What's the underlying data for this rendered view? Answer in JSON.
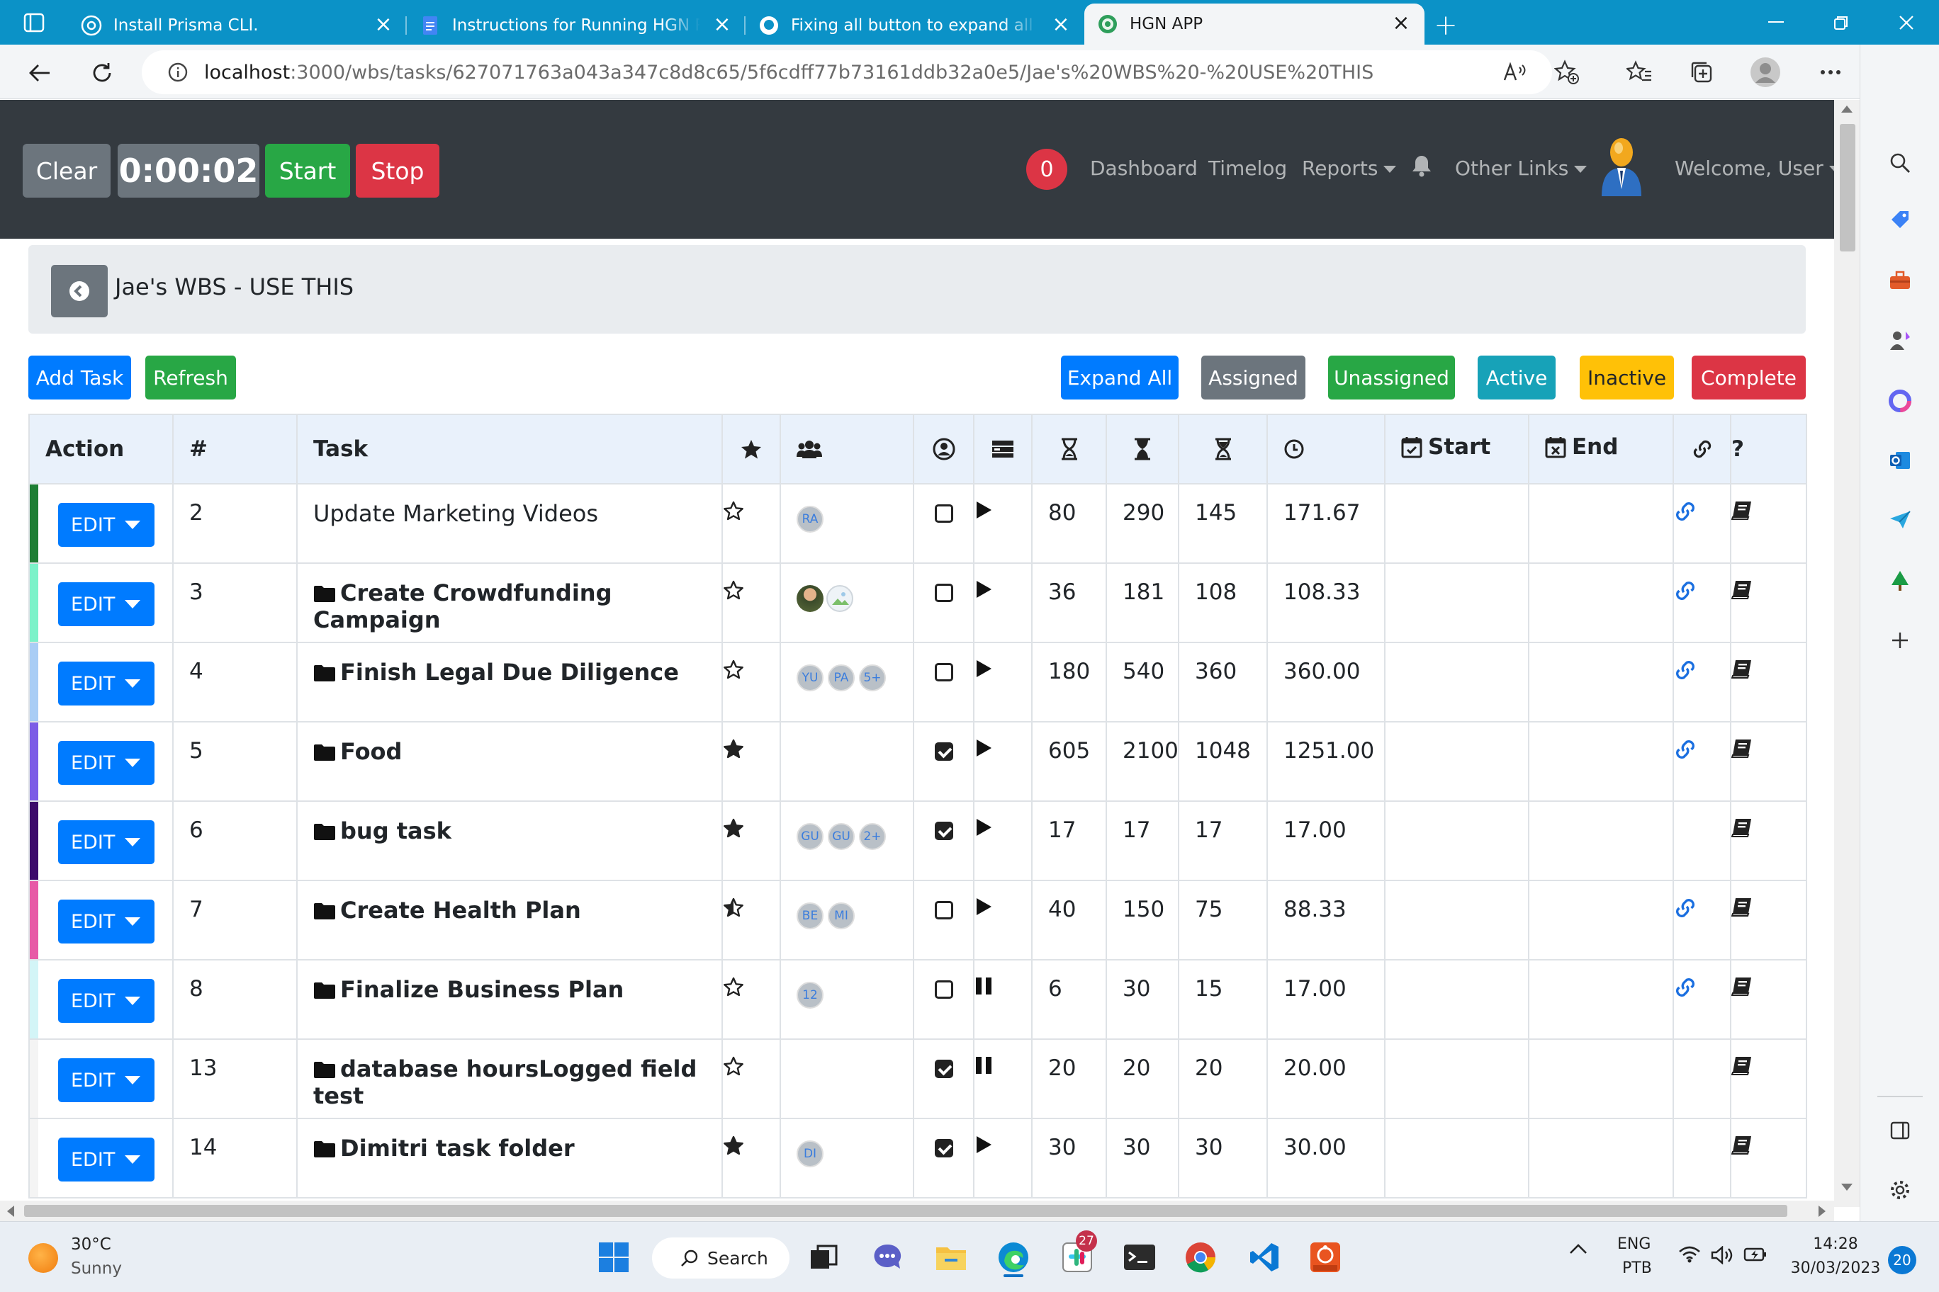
{
  "browser": {
    "tabs": [
      {
        "title": "Install Prisma CLI.",
        "icon": "openai-icon"
      },
      {
        "title": "Instructions for Running HGN Re",
        "icon": "docs-icon"
      },
      {
        "title": "Fixing all button to expand all ta",
        "icon": "github-icon"
      },
      {
        "title": "HGN APP",
        "icon": "hgn-icon",
        "active": true
      }
    ],
    "url_host": "localhost",
    "url_path": ":3000/wbs/tasks/627071763a043a347c8d8c65/5f6cdff77b73161ddb32a0e5/Jae's%20WBS%20-%20USE%20THIS"
  },
  "navbar": {
    "timer": {
      "clear": "Clear",
      "time": "0:00:02",
      "start": "Start",
      "stop": "Stop"
    },
    "notifications": "0",
    "links": {
      "dashboard": "Dashboard",
      "timelog": "Timelog",
      "reports": "Reports",
      "other_links": "Other Links",
      "welcome": "Welcome, User"
    }
  },
  "page": {
    "title": "Jae's WBS - USE THIS",
    "buttons": {
      "add_task": "Add Task",
      "refresh": "Refresh",
      "expand_all": "Expand All",
      "assigned": "Assigned",
      "unassigned": "Unassigned",
      "active": "Active",
      "inactive": "Inactive",
      "complete": "Complete"
    },
    "colors": {
      "primary": "#007bff",
      "success": "#28a745",
      "secondary": "#6c757d",
      "info": "#17a2b8",
      "warning": "#ffc107",
      "danger": "#dc3545"
    }
  },
  "table": {
    "headers": {
      "action": "Action",
      "num": "#",
      "task": "Task",
      "start": "Start",
      "end": "End",
      "help": "?"
    },
    "edit_label": "EDIT",
    "rows": [
      {
        "num": "2",
        "name": "Update Marketing Videos",
        "folder": false,
        "star": "empty",
        "avatars": [
          "RA"
        ],
        "photos": 0,
        "checked": false,
        "status": "play",
        "h1": "80",
        "h2": "290",
        "h3": "145",
        "h4": "171.67",
        "link": true,
        "color": "#1e7e34"
      },
      {
        "num": "3",
        "name": "Create Crowdfunding Campaign",
        "folder": true,
        "star": "empty",
        "avatars": [],
        "photos": 2,
        "checked": false,
        "status": "play",
        "h1": "36",
        "h2": "181",
        "h3": "108",
        "h4": "108.33",
        "link": true,
        "color": "#7cf2c9"
      },
      {
        "num": "4",
        "name": "Finish Legal Due Diligence",
        "folder": true,
        "star": "empty",
        "avatars": [
          "YU",
          "PA",
          "5+"
        ],
        "photos": 0,
        "checked": false,
        "status": "play",
        "h1": "180",
        "h2": "540",
        "h3": "360",
        "h4": "360.00",
        "link": true,
        "color": "#a9cdf5"
      },
      {
        "num": "5",
        "name": "Food",
        "folder": true,
        "star": "full",
        "avatars": [],
        "photos": 0,
        "checked": true,
        "status": "play",
        "h1": "605",
        "h2": "2100",
        "h3": "1048",
        "h4": "1251.00",
        "link": true,
        "color": "#7c5ce6"
      },
      {
        "num": "6",
        "name": "bug task",
        "folder": true,
        "star": "full",
        "avatars": [
          "GU",
          "GU",
          "2+"
        ],
        "photos": 0,
        "checked": true,
        "status": "play",
        "h1": "17",
        "h2": "17",
        "h3": "17",
        "h4": "17.00",
        "link": false,
        "color": "#3c0a6b"
      },
      {
        "num": "7",
        "name": "Create Health Plan",
        "folder": true,
        "star": "half",
        "avatars": [
          "BE",
          "MI"
        ],
        "photos": 0,
        "checked": false,
        "status": "play",
        "h1": "40",
        "h2": "150",
        "h3": "75",
        "h4": "88.33",
        "link": true,
        "color": "#e75aa6"
      },
      {
        "num": "8",
        "name": "Finalize Business Plan",
        "folder": true,
        "star": "empty",
        "avatars": [
          "12"
        ],
        "photos": 0,
        "checked": false,
        "status": "pause",
        "h1": "6",
        "h2": "30",
        "h3": "15",
        "h4": "17.00",
        "link": true,
        "color": "#d3f5f7"
      },
      {
        "num": "13",
        "name": "database hoursLogged field test",
        "folder": true,
        "star": "empty",
        "avatars": [],
        "photos": 0,
        "checked": true,
        "status": "pause",
        "h1": "20",
        "h2": "20",
        "h3": "20",
        "h4": "20.00",
        "link": false,
        "color": "#f4f4f4"
      },
      {
        "num": "14",
        "name": "Dimitri task folder",
        "folder": true,
        "star": "full",
        "avatars": [
          "DI"
        ],
        "photos": 0,
        "checked": true,
        "status": "play",
        "h1": "30",
        "h2": "30",
        "h3": "30",
        "h4": "30.00",
        "link": false,
        "color": "#f4f4f4"
      }
    ]
  },
  "taskbar": {
    "weather_temp": "30°C",
    "weather_desc": "Sunny",
    "search": "Search",
    "badge_count": "27",
    "lang": "ENG",
    "layout": "PTB",
    "time": "14:28",
    "date": "30/03/2023",
    "notif_count": "20"
  }
}
